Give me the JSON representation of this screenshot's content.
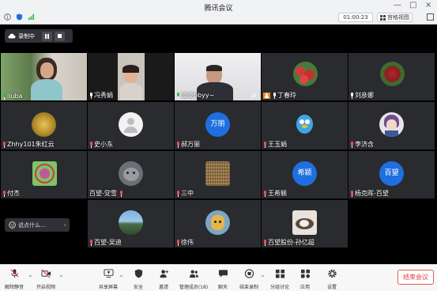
{
  "window": {
    "title": "腾讯会议",
    "controls": [
      "—",
      "□",
      "×"
    ],
    "timer": "01:00:23",
    "view_label": "宫格视图"
  },
  "recording": {
    "label": "录制中"
  },
  "participants": [
    {
      "name": "liuba",
      "mic": "active"
    },
    {
      "name": "冯秀娟",
      "mic": "normal"
    },
    {
      "name": "波波bbyy~",
      "mic": "active"
    },
    {
      "name": "丁春玲",
      "mic": "normal"
    },
    {
      "name": "刘彦娜",
      "mic": "normal"
    },
    {
      "name": "Zhhy101朱红云",
      "mic": "muted"
    },
    {
      "name": "史小东",
      "mic": "muted"
    },
    {
      "name": "郝万丽",
      "mic": "muted",
      "avatar_text": "万丽"
    },
    {
      "name": "王玉娟",
      "mic": "muted"
    },
    {
      "name": "李济含",
      "mic": "muted"
    },
    {
      "name": "付杰",
      "mic": "muted"
    },
    {
      "name": "百望-党雪",
      "mic": "muted"
    },
    {
      "name": "三中",
      "mic": "muted"
    },
    {
      "name": "王希颖",
      "mic": "muted",
      "avatar_text": "希颖"
    },
    {
      "name": "杨克晖-百望",
      "mic": "muted",
      "avatar_text": "百望"
    },
    {
      "name": "百望-吴迪",
      "mic": "muted"
    },
    {
      "name": "徐伟",
      "mic": "muted"
    },
    {
      "name": "百望股份-孙亿超",
      "mic": "muted"
    }
  ],
  "chat": {
    "placeholder": "说点什么..."
  },
  "toolbar": {
    "unmute": "解除静音",
    "video": "开启视频",
    "share": "共享屏幕",
    "security": "安全",
    "invite": "邀请",
    "members": "管理成员(18)",
    "chat": "聊天",
    "end_recording": "结束录制",
    "breakout": "分组讨论",
    "apps": "应用",
    "settings": "设置",
    "end_meeting": "结束会议"
  },
  "colors": {
    "accent_blue": "#1f6fe0",
    "end_red": "#e03b3b",
    "tile_bg": "#2a2b2f"
  }
}
